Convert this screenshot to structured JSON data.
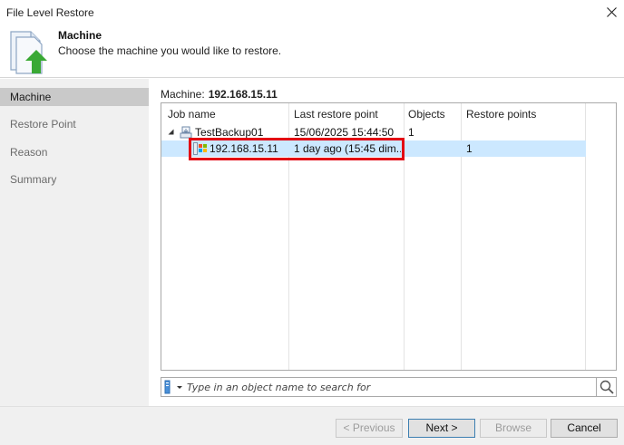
{
  "window": {
    "title": "File Level Restore"
  },
  "header": {
    "title": "Machine",
    "subtitle": "Choose the machine you would like to restore."
  },
  "sidebar": {
    "items": [
      {
        "label": "Machine",
        "active": true
      },
      {
        "label": "Restore Point",
        "active": false
      },
      {
        "label": "Reason",
        "active": false
      },
      {
        "label": "Summary",
        "active": false
      }
    ]
  },
  "main": {
    "machine_label": "Machine:",
    "machine_value": "192.168.15.11"
  },
  "grid": {
    "columns": [
      "Job name",
      "Last restore point",
      "Objects",
      "Restore points"
    ],
    "rows": [
      {
        "name": "TestBackup01",
        "last_restore": "15/06/2025 15:44:50",
        "objects": "1",
        "restore_points": "",
        "level": 0,
        "expanded": true,
        "selected": false,
        "icon": "backup-job-icon"
      },
      {
        "name": "192.168.15.11",
        "last_restore": "1 day ago (15:45 dim...",
        "objects": "",
        "restore_points": "1",
        "level": 1,
        "selected": true,
        "icon": "windows-machine-icon"
      }
    ]
  },
  "search": {
    "placeholder": "Type in an object name to search for"
  },
  "footer": {
    "previous": "< Previous",
    "next": "Next >",
    "browse": "Browse",
    "cancel": "Cancel"
  },
  "colors": {
    "accent_green": "#3aa935",
    "selection": "#cce8ff",
    "highlight_red": "#e30613",
    "sidebar_bg": "#f0f0f0",
    "sidebar_active": "#c9c9c9"
  }
}
